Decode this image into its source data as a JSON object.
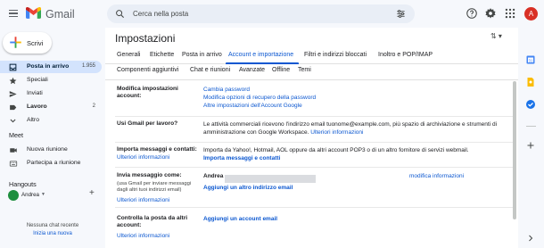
{
  "header": {
    "brand": "Gmail",
    "search_placeholder": "Cerca nella posta",
    "avatar_letter": "A"
  },
  "sidebar": {
    "compose_label": "Scrivi",
    "items": [
      {
        "label": "Posta in arrivo",
        "count": "1.955",
        "icon": "inbox-icon",
        "active": true
      },
      {
        "label": "Speciali",
        "count": "",
        "icon": "star-icon"
      },
      {
        "label": "Inviati",
        "count": "",
        "icon": "send-icon"
      },
      {
        "label": "Lavoro",
        "count": "2",
        "icon": "label-icon"
      },
      {
        "label": "Altro",
        "count": "",
        "icon": "chevron-down-icon"
      }
    ],
    "meet": {
      "title": "Meet",
      "items": [
        {
          "label": "Nuova riunione",
          "icon": "video-icon"
        },
        {
          "label": "Partecipa a riunione",
          "icon": "keyboard-icon"
        }
      ]
    },
    "hangouts": {
      "title": "Hangouts",
      "user": "Andrea",
      "empty_text": "Nessuna chat recente",
      "start_link": "Inizia una nuova"
    }
  },
  "main": {
    "title": "Impostazioni",
    "tabs_row1": [
      "Generali",
      "Etichette",
      "Posta in arrivo",
      "Account e importazione",
      "Filtri e indirizzi bloccati",
      "Inoltro e POP/IMAP"
    ],
    "tabs_row2": [
      "Componenti aggiuntivi",
      "Chat e riunioni",
      "Avanzate",
      "Offline",
      "Temi"
    ],
    "active_tab": "Account e importazione",
    "settings": [
      {
        "label": "Modifica impostazioni account:",
        "links": [
          "Cambia password",
          "Modifica opzioni di recupero della password",
          "Altre impostazioni dell'Account Google"
        ]
      },
      {
        "label": "Usi Gmail per lavoro?",
        "text": "Le attività commerciali ricevono l'indirizzo email tuonome@example.com, più spazio di archiviazione e strumenti di amministrazione con Google Workspace.",
        "link": "Ulteriori informazioni"
      },
      {
        "label": "Importa messaggi e contatti:",
        "sub_link": "Ulteriori informazioni",
        "text": "Importa da Yahoo!, Hotmail, AOL oppure da altri account POP3 o di un altro fornitore di servizi webmail.",
        "action": "Importa messaggi e contatti"
      },
      {
        "label": "Invia messaggio come:",
        "sub": "(usa Gmail per inviare messaggi dagli altri tuoi indirizzi email)",
        "sub_link": "Ulteriori informazioni",
        "account_name": "Andrea",
        "edit_link": "modifica informazioni",
        "action": "Aggiungi un altro indirizzo email"
      },
      {
        "label": "Controlla la posta da altri account:",
        "sub_link": "Ulteriori informazioni",
        "action": "Aggiungi un account email"
      }
    ]
  },
  "colors": {
    "accent": "#0b57d0",
    "background": "#f6f8fc",
    "active_nav": "#d3e3fd",
    "avatar": "#d93025"
  }
}
